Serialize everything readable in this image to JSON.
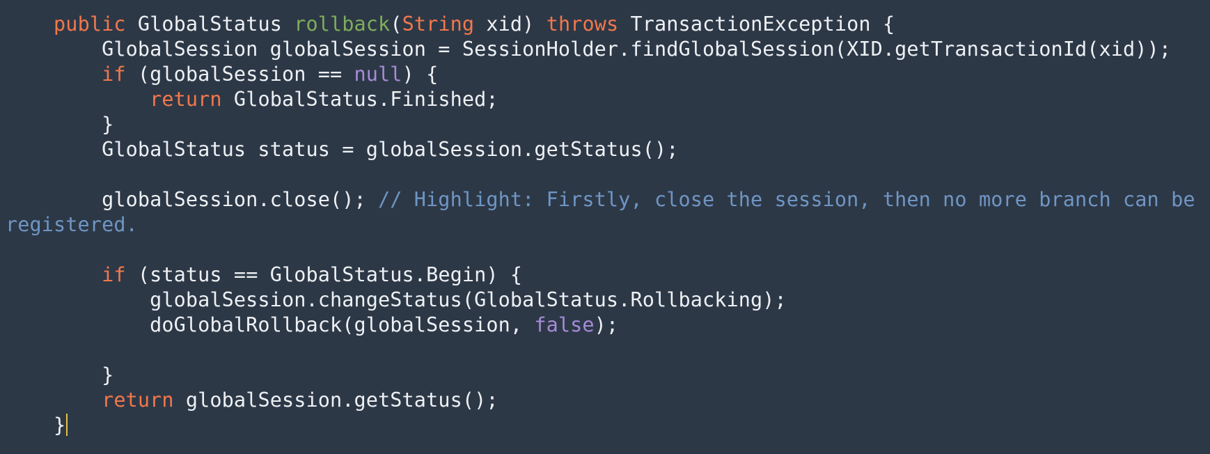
{
  "editor": {
    "lines": [
      [
        {
          "t": "    "
        },
        {
          "t": "public",
          "c": "kw"
        },
        {
          "t": " GlobalStatus "
        },
        {
          "t": "rollback",
          "c": "fn"
        },
        {
          "t": "("
        },
        {
          "t": "String",
          "c": "kw"
        },
        {
          "t": " xid) "
        },
        {
          "t": "throws",
          "c": "kw"
        },
        {
          "t": " TransactionException {"
        }
      ],
      [
        {
          "t": "        GlobalSession globalSession = SessionHolder.findGlobalSession(XID.getTransactionId(xid));"
        }
      ],
      [
        {
          "t": "        "
        },
        {
          "t": "if",
          "c": "kw"
        },
        {
          "t": " (globalSession == "
        },
        {
          "t": "null",
          "c": "lit"
        },
        {
          "t": ") {"
        }
      ],
      [
        {
          "t": "            "
        },
        {
          "t": "return",
          "c": "kw"
        },
        {
          "t": " GlobalStatus.Finished;"
        }
      ],
      [
        {
          "t": "        }"
        }
      ],
      [
        {
          "t": "        GlobalStatus status = globalSession.getStatus();"
        }
      ],
      [],
      [
        {
          "t": "        globalSession.close(); "
        },
        {
          "t": "// Highlight: Firstly, close the session, then no more branch can be",
          "c": "cmt"
        }
      ],
      [
        {
          "t": "registered.",
          "c": "cmt"
        }
      ],
      [],
      [
        {
          "t": "        "
        },
        {
          "t": "if",
          "c": "kw"
        },
        {
          "t": " (status == GlobalStatus.Begin) {"
        }
      ],
      [
        {
          "t": "            globalSession.changeStatus(GlobalStatus.Rollbacking);"
        }
      ],
      [
        {
          "t": "            doGlobalRollback(globalSession, "
        },
        {
          "t": "false",
          "c": "lit"
        },
        {
          "t": ");"
        }
      ],
      [],
      [
        {
          "t": "        }"
        }
      ],
      [
        {
          "t": "        "
        },
        {
          "t": "return",
          "c": "kw"
        },
        {
          "t": " globalSession.getStatus();"
        }
      ],
      [
        {
          "t": "    }"
        }
      ]
    ]
  }
}
